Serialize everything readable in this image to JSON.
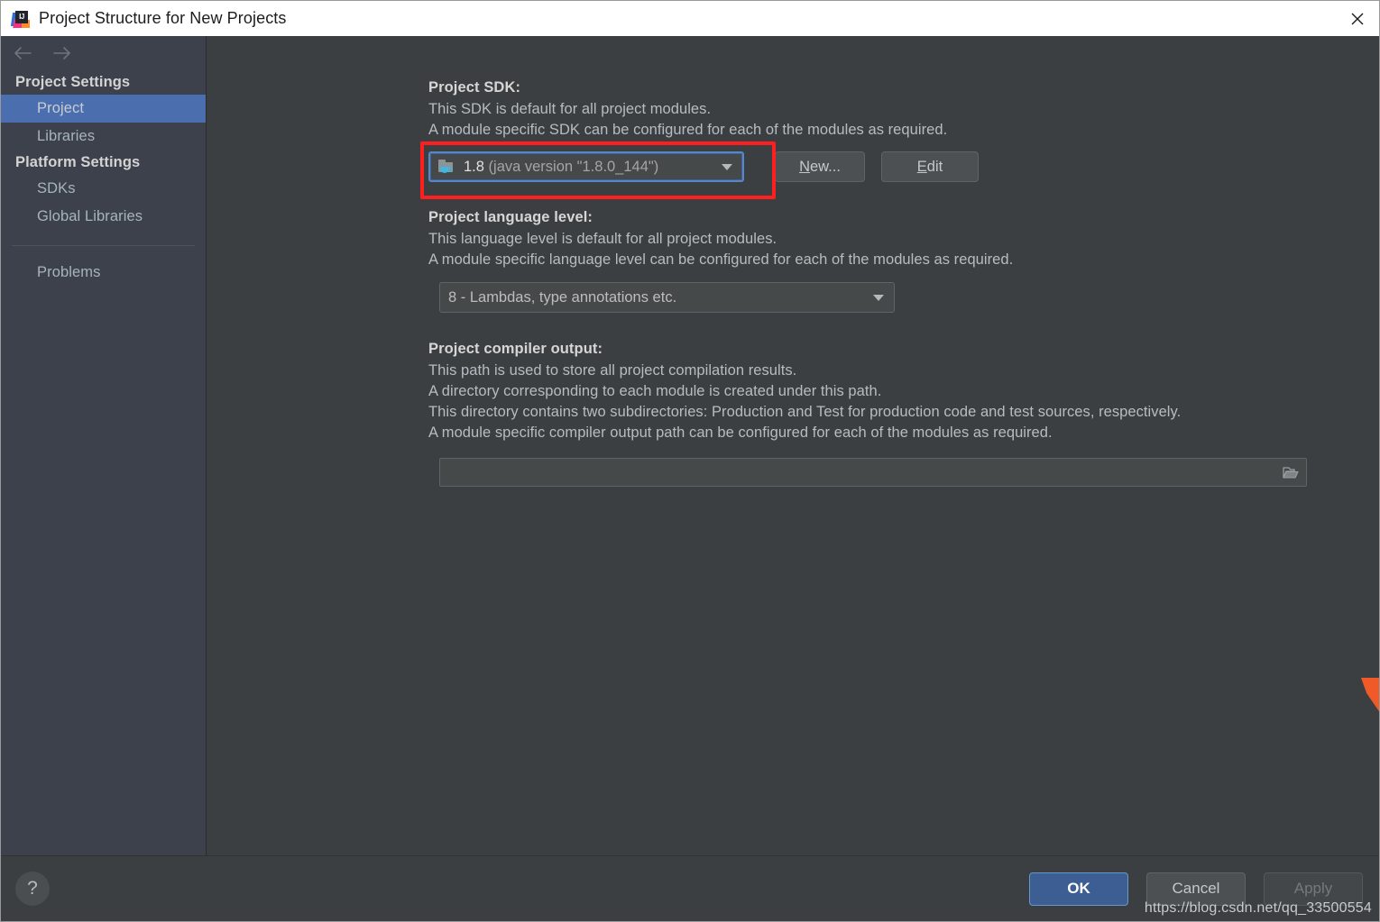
{
  "window": {
    "title": "Project Structure for New Projects",
    "app_icon": "intellij-idea-icon",
    "close_icon": "close-icon"
  },
  "sidebar": {
    "nav": {
      "back_icon": "arrow-left-icon",
      "forward_icon": "arrow-right-icon"
    },
    "groups": [
      {
        "title": "Project Settings",
        "items": [
          {
            "label": "Project",
            "selected": true
          },
          {
            "label": "Libraries",
            "selected": false
          }
        ]
      },
      {
        "title": "Platform Settings",
        "items": [
          {
            "label": "SDKs",
            "selected": false
          },
          {
            "label": "Global Libraries",
            "selected": false
          }
        ]
      }
    ],
    "extra_items": [
      {
        "label": "Problems",
        "selected": false
      }
    ],
    "selection_color": "#4b6eaf"
  },
  "main": {
    "sdk_section": {
      "title": "Project SDK:",
      "description_lines": [
        "This SDK is default for all project modules.",
        "A module specific SDK can be configured for each of the modules as required."
      ],
      "combo": {
        "icon": "sdk-folder-java-icon",
        "value_strong": "1.8",
        "value_dim": "(java version \"1.8.0_144\")",
        "dropdown_icon": "chevron-down-icon",
        "focused": true,
        "highlighted": true,
        "highlight_color": "#ff1f1f"
      },
      "new_button": {
        "label_mnemonic": "N",
        "label_rest": "ew..."
      },
      "edit_button": {
        "label_mnemonic": "E",
        "label_rest": "dit"
      }
    },
    "language_level_section": {
      "title": "Project language level:",
      "description_lines": [
        "This language level is default for all project modules.",
        "A module specific language level can be configured for each of the modules as required."
      ],
      "combo": {
        "value": "8 - Lambdas, type annotations etc.",
        "dropdown_icon": "chevron-down-icon"
      }
    },
    "compiler_output_section": {
      "title": "Project compiler output:",
      "description_lines": [
        "This path is used to store all project compilation results.",
        "A directory corresponding to each module is created under this path.",
        "This directory contains two subdirectories: Production and Test for production code and test sources, respectively.",
        "A module specific compiler output path can be configured for each of the modules as required."
      ],
      "field": {
        "value": "",
        "placeholder": "",
        "browse_icon": "folder-open-icon"
      }
    }
  },
  "footer": {
    "help_icon": "question-mark-icon",
    "ok_label": "OK",
    "cancel_label": "Cancel",
    "apply_label": "Apply",
    "apply_disabled": true,
    "watermark": "https://blog.csdn.net/qq_33500554"
  }
}
